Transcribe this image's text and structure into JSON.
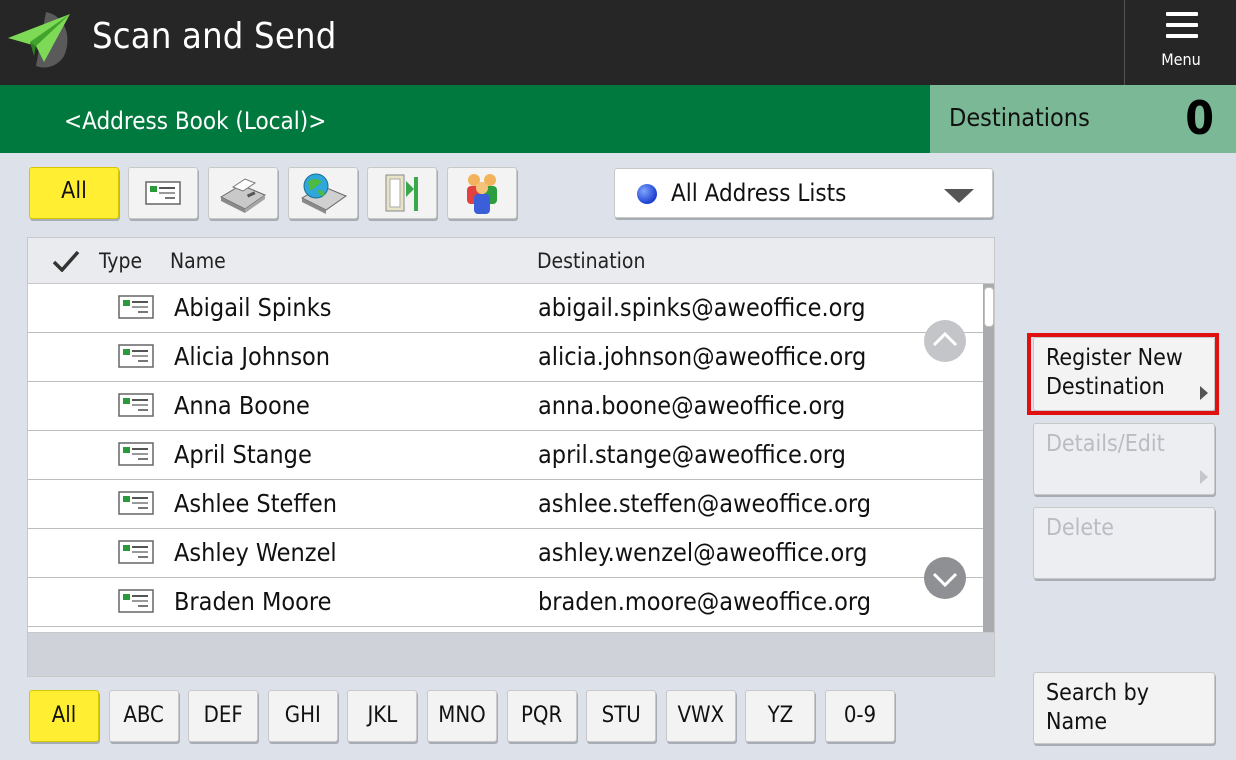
{
  "titlebar": {
    "title": "Scan and Send",
    "menu_label": "Menu",
    "logo_icon": "paper-plane-icon"
  },
  "header": {
    "address_book_title": "<Address Book (Local)>",
    "destinations_label": "Destinations",
    "destinations_count": "0"
  },
  "filters": {
    "all_label": "All",
    "icons": [
      "email-icon",
      "fax-icon",
      "ifax-icon",
      "folder-icon",
      "group-icon"
    ],
    "address_list_label": "All Address Lists"
  },
  "table": {
    "columns": {
      "type": "Type",
      "name": "Name",
      "destination": "Destination"
    },
    "rows": [
      {
        "name": "Abigail Spinks",
        "destination": "abigail.spinks@aweoffice.org"
      },
      {
        "name": "Alicia Johnson",
        "destination": "alicia.johnson@aweoffice.org"
      },
      {
        "name": "Anna Boone",
        "destination": "anna.boone@aweoffice.org"
      },
      {
        "name": "April Stange",
        "destination": "april.stange@aweoffice.org"
      },
      {
        "name": "Ashlee Steffen",
        "destination": "ashlee.steffen@aweoffice.org"
      },
      {
        "name": "Ashley Wenzel",
        "destination": "ashley.wenzel@aweoffice.org"
      },
      {
        "name": "Braden Moore",
        "destination": "braden.moore@aweoffice.org"
      }
    ]
  },
  "alphabet": [
    "All",
    "ABC",
    "DEF",
    "GHI",
    "JKL",
    "MNO",
    "PQR",
    "STU",
    "VWX",
    "YZ",
    "0-9"
  ],
  "actions": {
    "register": "Register New Destination",
    "details": "Details/Edit",
    "delete": "Delete",
    "search": "Search by Name"
  },
  "colors": {
    "titlebar": "#262626",
    "header_green": "#00793e",
    "destinations_panel": "#7ab896",
    "active_yellow": "#ffee32",
    "highlight_red": "#e01010"
  }
}
